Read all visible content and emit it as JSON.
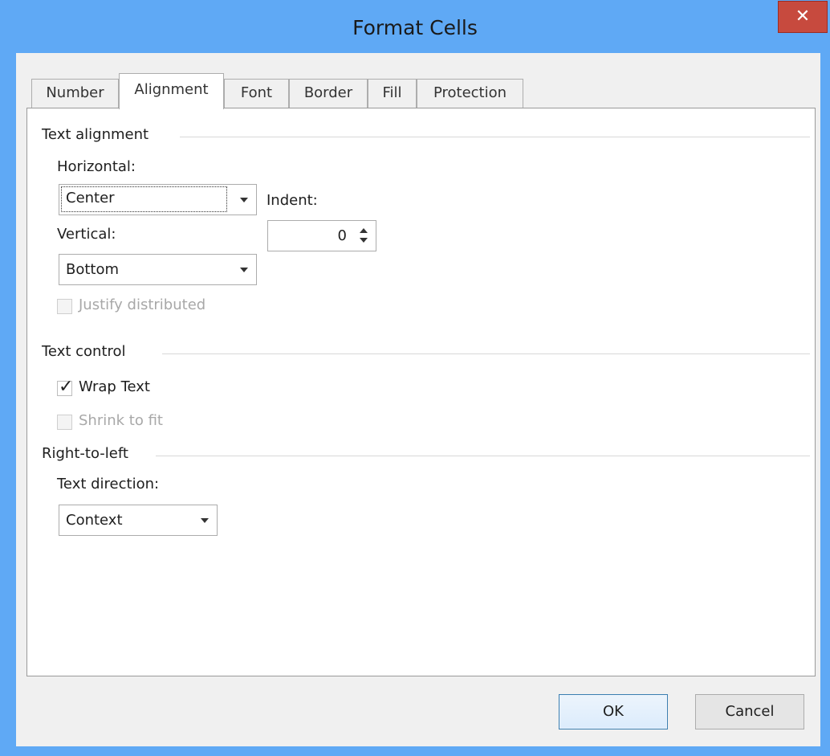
{
  "window": {
    "title": "Format Cells"
  },
  "tabs": [
    {
      "label": "Number"
    },
    {
      "label": "Alignment"
    },
    {
      "label": "Font"
    },
    {
      "label": "Border"
    },
    {
      "label": "Fill"
    },
    {
      "label": "Protection"
    }
  ],
  "active_tab": "Alignment",
  "text_alignment": {
    "section": "Text alignment",
    "horizontal_label": "Horizontal:",
    "horizontal_value": "Center",
    "vertical_label": "Vertical:",
    "vertical_value": "Bottom",
    "indent_label": "Indent:",
    "indent_value": "0",
    "justify_label": "Justify distributed",
    "justify_checked": false,
    "justify_enabled": false
  },
  "text_control": {
    "section": "Text control",
    "wrap_label": "Wrap Text",
    "wrap_checked": true,
    "shrink_label": "Shrink to fit",
    "shrink_checked": false,
    "shrink_enabled": false
  },
  "rtl": {
    "section": "Right-to-left",
    "direction_label": "Text direction:",
    "direction_value": "Context"
  },
  "buttons": {
    "ok": "OK",
    "cancel": "Cancel"
  },
  "colors": {
    "title_bar": "#5fa9f5",
    "close": "#c74a3e",
    "dialog_bg": "#f0f0f0"
  }
}
